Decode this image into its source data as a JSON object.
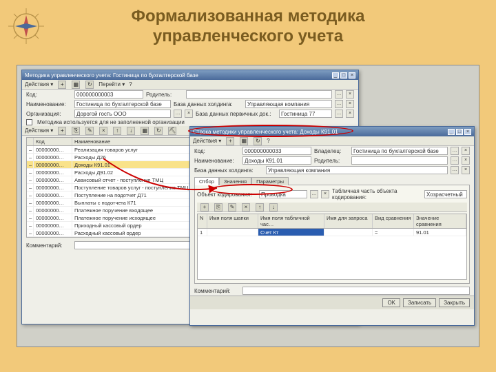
{
  "page": {
    "title_line1": "Формализованная методика",
    "title_line2": "управленческого учета"
  },
  "win1": {
    "title": "Методика управленческого учета: Гостиница по бухгалтерской базе",
    "menu_actions": "Действия ▾",
    "menu_goto": "Перейти ▾",
    "menu_help": "?",
    "fields": {
      "code_label": "Код:",
      "code": "000000000003",
      "name_label": "Наименование:",
      "name": "Гостиница по бухгалтерской базе",
      "org_label": "Организация:",
      "org": "Дорогой гость ООО",
      "parent_label": "Родитель:",
      "parent": "",
      "holding_db_label": "База данных холдинга:",
      "holding_db": "Управляющая компания",
      "primary_db_label": "База данных первичных док.:",
      "primary_db": "Гостиница 77",
      "checkbox": "Методика используется для не заполненной организации"
    },
    "grid_actions": "Действия ▾",
    "grid_headers": {
      "code": "Код",
      "name": "Наименование"
    },
    "rows": [
      {
        "code": "00000000…",
        "name": "Реализация товаров услуг"
      },
      {
        "code": "00000000…",
        "name": "Расходы Д26"
      },
      {
        "code": "00000000…",
        "name": "Доходы К91.01"
      },
      {
        "code": "00000000…",
        "name": "Расходы Д91.02"
      },
      {
        "code": "00000000…",
        "name": "Авансовый отчет - поступление ТМЦ"
      },
      {
        "code": "00000000…",
        "name": "Поступление товаров услуг - поступление ТМЦ"
      },
      {
        "code": "00000000…",
        "name": "Поступление на подотчет Д71"
      },
      {
        "code": "00000000…",
        "name": "Выплаты с подотчета К71"
      },
      {
        "code": "00000000…",
        "name": "Платежное поручение входящее"
      },
      {
        "code": "00000000…",
        "name": "Платежное поручение исходящее"
      },
      {
        "code": "00000000…",
        "name": "Приходный кассовый ордер"
      },
      {
        "code": "00000000…",
        "name": "Расходный кассовый ордер"
      }
    ],
    "comment_label": "Комментарий:"
  },
  "win2": {
    "title": "Строка методики управленческого учета: Доходы К91.01",
    "menu_actions": "Действия ▾",
    "menu_help": "?",
    "fields": {
      "code_label": "Код:",
      "code": "000000000033",
      "name_label": "Наименование:",
      "name": "Доходы К91.01",
      "owner_label": "Владелец:",
      "owner": "Гостиница по бухгалтерской базе",
      "parent_label": "Родитель:",
      "parent": "",
      "holding_db_label": "База данных холдинга:",
      "holding_db": "Управляющая компания"
    },
    "tabs": {
      "t1": "Отбор",
      "t2": "Значения",
      "t3": "Параметры"
    },
    "obj_code_label": "Объект кодирования:",
    "obj_code": "Проводка",
    "tab_part_label": "Табличная часть объекта кодирования:",
    "tab_part": "Хозрасчетный",
    "grid_headers": {
      "n": "N",
      "cap": "Имя поля шапки",
      "tab": "Имя поля табличной час…",
      "req": "Имя для запроса",
      "cmp": "Вид сравнения",
      "val": "Значение сравнения"
    },
    "row": {
      "n": "1",
      "cap": "",
      "tab": "Счет Кт",
      "req": "",
      "cmp": "=",
      "val": "91.01"
    },
    "comment_label": "Комментарий:",
    "buttons": {
      "ok": "OK",
      "write": "Записать",
      "close": "Закрыть"
    }
  }
}
